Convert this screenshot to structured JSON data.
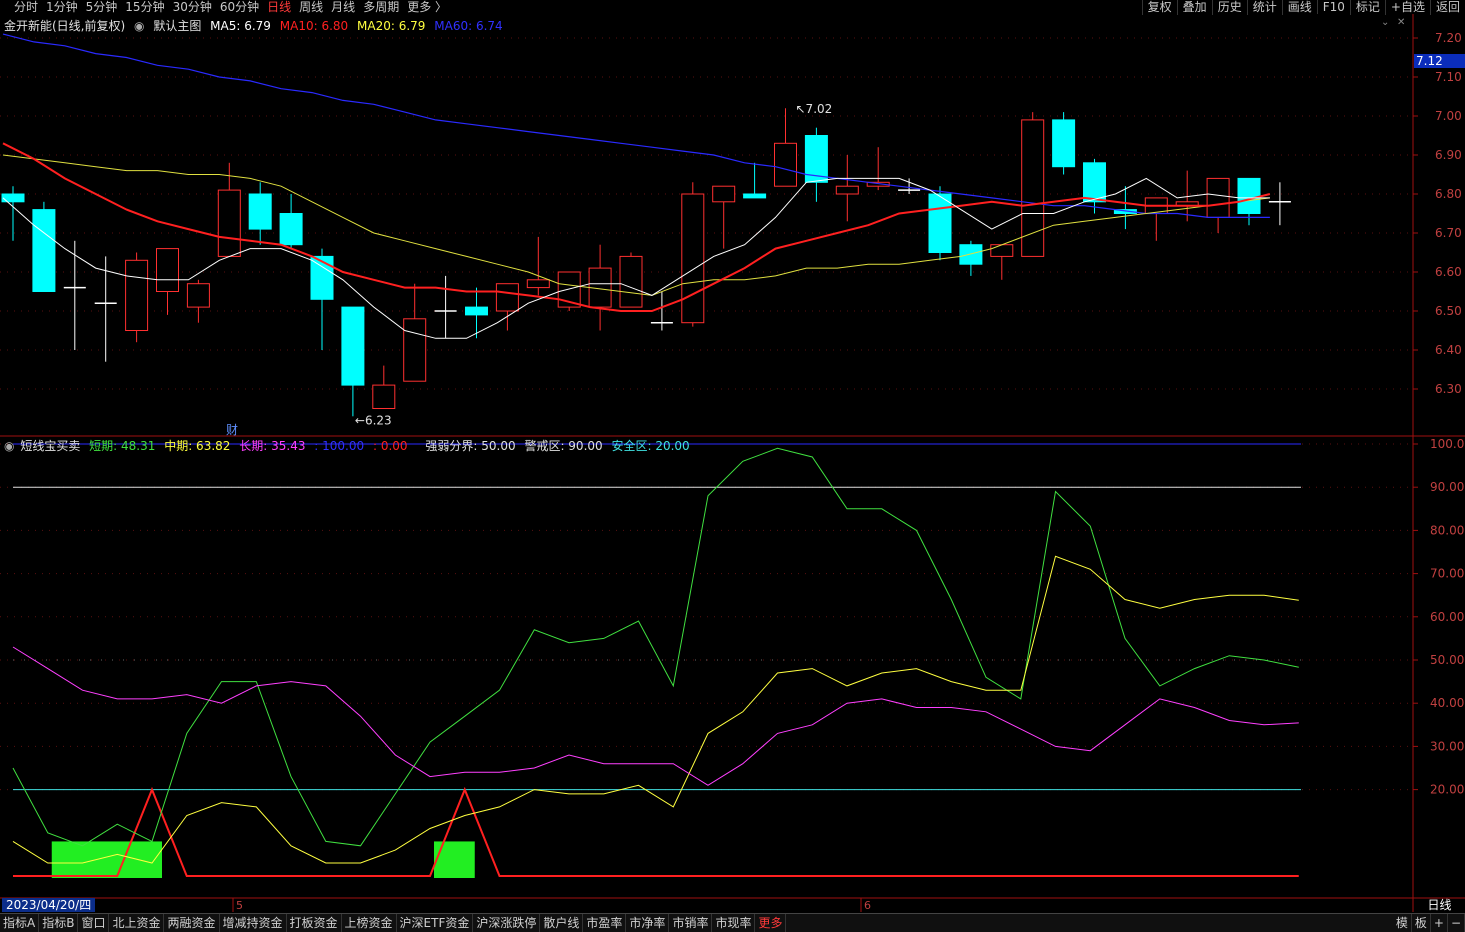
{
  "toolbar": {
    "periods": [
      "分时",
      "1分钟",
      "5分钟",
      "15分钟",
      "30分钟",
      "60分钟",
      "日线",
      "周线",
      "月线",
      "多周期",
      "更多 〉"
    ],
    "active_period": "日线",
    "tools": [
      "复权",
      "叠加",
      "历史",
      "统计",
      "画线",
      "F10",
      "标记",
      "+自选",
      "返回"
    ]
  },
  "main_legend": {
    "title": "金开新能(日线,前复权)",
    "main_label": "默认主图",
    "ma5": "MA5: 6.79",
    "ma10": "MA10: 6.80",
    "ma20": "MA20: 6.79",
    "ma60": "MA60: 6.74",
    "colors": {
      "ma5": "#ffffff",
      "ma10": "#ff2020",
      "ma20": "#ffff40",
      "ma60": "#2020ff"
    }
  },
  "sub_legend": {
    "title": "短线宝买卖",
    "short": "短期: 48.31",
    "mid": "中期: 63.82",
    "long": "长期: 35.43",
    "blue": ": 100.00",
    "red": ": 0.00",
    "strong": "强弱分界: 50.00",
    "warn": "警戒区: 90.00",
    "safe": "安全区: 20.00"
  },
  "price_axis": [
    "7.20",
    "7.10",
    "7.00",
    "6.90",
    "6.80",
    "6.70",
    "6.60",
    "6.50",
    "6.40",
    "6.30"
  ],
  "current_price": "7.12",
  "osc_axis": [
    "100.0",
    "90.00",
    "80.00",
    "70.00",
    "60.00",
    "50.00",
    "40.00",
    "30.00",
    "20.00"
  ],
  "annotations": {
    "high": "7.02",
    "low": "6.23",
    "cai": "财"
  },
  "month_labels": [
    "5",
    "6"
  ],
  "date_label": "2023/04/20/四",
  "period_label": "日线",
  "bottom_tabs": [
    "指标A",
    "指标B",
    "窗口",
    "北上资金",
    "两融资金",
    "增减持资金",
    "打板资金",
    "上榜资金",
    "沪深ETF资金",
    "沪深涨跌停",
    "散户线",
    "市盈率",
    "市净率",
    "市销率",
    "市现率",
    "更多"
  ],
  "bottom_right": [
    "模",
    "板",
    "+",
    "−"
  ],
  "chart_data": [
    {
      "type": "candlestick",
      "title": "金开新能(日线,前复权)",
      "ylim": [
        6.2,
        7.25
      ],
      "candles": [
        [
          6.8,
          6.78,
          6.82,
          6.68
        ],
        [
          6.76,
          6.55,
          6.78,
          6.55
        ],
        [
          6.56,
          6.56,
          6.68,
          6.4
        ],
        [
          6.52,
          6.52,
          6.64,
          6.37
        ],
        [
          6.45,
          6.63,
          6.65,
          6.42
        ],
        [
          6.55,
          6.66,
          6.66,
          6.49
        ],
        [
          6.51,
          6.57,
          6.58,
          6.47
        ],
        [
          6.64,
          6.81,
          6.88,
          6.64
        ],
        [
          6.8,
          6.71,
          6.83,
          6.67
        ],
        [
          6.75,
          6.67,
          6.8,
          6.66
        ],
        [
          6.64,
          6.53,
          6.66,
          6.4
        ],
        [
          6.51,
          6.31,
          6.51,
          6.23
        ],
        [
          6.25,
          6.31,
          6.36,
          6.25
        ],
        [
          6.32,
          6.48,
          6.57,
          6.32
        ],
        [
          6.5,
          6.5,
          6.59,
          6.43
        ],
        [
          6.51,
          6.49,
          6.56,
          6.43
        ],
        [
          6.5,
          6.57,
          6.57,
          6.45
        ],
        [
          6.56,
          6.58,
          6.69,
          6.54
        ],
        [
          6.51,
          6.6,
          6.6,
          6.5
        ],
        [
          6.51,
          6.61,
          6.67,
          6.45
        ],
        [
          6.51,
          6.64,
          6.65,
          6.51
        ],
        [
          6.47,
          6.47,
          6.55,
          6.45
        ],
        [
          6.47,
          6.8,
          6.83,
          6.46
        ],
        [
          6.78,
          6.82,
          6.82,
          6.66
        ],
        [
          6.8,
          6.79,
          6.88,
          6.79
        ],
        [
          6.82,
          6.93,
          7.02,
          6.82
        ],
        [
          6.95,
          6.83,
          6.97,
          6.78
        ],
        [
          6.8,
          6.82,
          6.9,
          6.73
        ],
        [
          6.82,
          6.83,
          6.92,
          6.81
        ],
        [
          6.81,
          6.81,
          6.84,
          6.8
        ],
        [
          6.8,
          6.65,
          6.82,
          6.63
        ],
        [
          6.67,
          6.62,
          6.68,
          6.59
        ],
        [
          6.64,
          6.67,
          6.67,
          6.58
        ],
        [
          6.64,
          6.99,
          7.01,
          6.64
        ],
        [
          6.99,
          6.87,
          7.01,
          6.85
        ],
        [
          6.88,
          6.78,
          6.89,
          6.75
        ],
        [
          6.76,
          6.75,
          6.82,
          6.71
        ],
        [
          6.75,
          6.79,
          6.79,
          6.68
        ],
        [
          6.77,
          6.78,
          6.86,
          6.73
        ],
        [
          6.74,
          6.84,
          6.84,
          6.7
        ],
        [
          6.84,
          6.75,
          6.84,
          6.72
        ],
        [
          6.78,
          6.78,
          6.83,
          6.72
        ]
      ],
      "ma5": [
        6.79,
        6.72,
        6.66,
        6.61,
        6.59,
        6.58,
        6.58,
        6.63,
        6.66,
        6.66,
        6.63,
        6.58,
        6.51,
        6.45,
        6.43,
        6.43,
        6.47,
        6.52,
        6.55,
        6.57,
        6.57,
        6.54,
        6.59,
        6.64,
        6.67,
        6.74,
        6.83,
        6.84,
        6.84,
        6.84,
        6.81,
        6.76,
        6.71,
        6.75,
        6.75,
        6.78,
        6.8,
        6.84,
        6.79,
        6.8,
        6.79,
        6.79
      ],
      "ma10": [
        6.93,
        6.89,
        6.84,
        6.8,
        6.76,
        6.73,
        6.71,
        6.69,
        6.68,
        6.67,
        6.64,
        6.6,
        6.58,
        6.56,
        6.56,
        6.55,
        6.55,
        6.54,
        6.53,
        6.51,
        6.5,
        6.5,
        6.53,
        6.57,
        6.61,
        6.66,
        6.68,
        6.7,
        6.72,
        6.75,
        6.76,
        6.77,
        6.78,
        6.77,
        6.78,
        6.79,
        6.78,
        6.77,
        6.77,
        6.77,
        6.78,
        6.8
      ],
      "ma20": [
        6.9,
        6.89,
        6.88,
        6.87,
        6.86,
        6.86,
        6.85,
        6.85,
        6.84,
        6.82,
        6.78,
        6.74,
        6.7,
        6.68,
        6.66,
        6.64,
        6.62,
        6.6,
        6.57,
        6.56,
        6.55,
        6.54,
        6.57,
        6.58,
        6.58,
        6.59,
        6.61,
        6.61,
        6.62,
        6.62,
        6.63,
        6.64,
        6.66,
        6.69,
        6.72,
        6.73,
        6.74,
        6.75,
        6.76,
        6.77,
        6.78,
        6.79
      ],
      "ma60": [
        7.21,
        7.19,
        7.18,
        7.16,
        7.15,
        7.13,
        7.12,
        7.1,
        7.09,
        7.07,
        7.06,
        7.04,
        7.03,
        7.01,
        6.99,
        6.98,
        6.97,
        6.96,
        6.95,
        6.94,
        6.93,
        6.92,
        6.91,
        6.9,
        6.88,
        6.87,
        6.85,
        6.84,
        6.83,
        6.82,
        6.81,
        6.8,
        6.79,
        6.78,
        6.77,
        6.77,
        6.76,
        6.75,
        6.75,
        6.74,
        6.74,
        6.74
      ]
    },
    {
      "type": "line",
      "title": "短线宝买卖",
      "ylim": [
        0,
        105
      ],
      "reference_lines": {
        "top": 100,
        "warn": 90,
        "strong": 50,
        "safe": 20
      },
      "series": [
        {
          "name": "短期",
          "color": "#40e040",
          "values": [
            25,
            10,
            7,
            12,
            8,
            33,
            45,
            45,
            23,
            8,
            7,
            19,
            31,
            37,
            43,
            57,
            54,
            55,
            59,
            44,
            88,
            96,
            99,
            97,
            85,
            85,
            80,
            64,
            46,
            41,
            89,
            81,
            55,
            44,
            48,
            51,
            50,
            48.31
          ]
        },
        {
          "name": "中期",
          "color": "#ffff40",
          "values": [
            8,
            3,
            3,
            5,
            3,
            14,
            17,
            16,
            7,
            3,
            3,
            6,
            11,
            14,
            16,
            20,
            19,
            19,
            21,
            16,
            33,
            38,
            47,
            48,
            44,
            47,
            48,
            45,
            43,
            43,
            74,
            71,
            64,
            62,
            64,
            65,
            65,
            63.82
          ]
        },
        {
          "name": "长期",
          "color": "#ff40ff",
          "values": [
            53,
            48,
            43,
            41,
            41,
            42,
            40,
            44,
            45,
            44,
            37,
            28,
            23,
            24,
            24,
            25,
            28,
            26,
            26,
            26,
            21,
            26,
            33,
            35,
            40,
            41,
            39,
            39,
            38,
            34,
            30,
            29,
            35,
            41,
            39,
            36,
            35,
            35.43
          ]
        }
      ],
      "signal": {
        "color": "#ff2020",
        "peaks": [
          4,
          13
        ],
        "peak_value": 20
      },
      "green_blocks": [
        [
          1,
          4
        ],
        [
          12,
          13
        ]
      ]
    }
  ]
}
